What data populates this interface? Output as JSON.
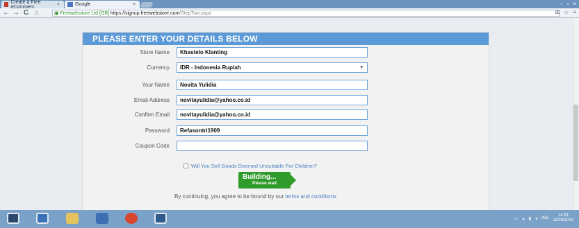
{
  "browser": {
    "tabs": [
      {
        "label": "Create a Free eCommerc",
        "close": "×"
      },
      {
        "label": "Google",
        "close": "×"
      }
    ],
    "window_controls": [
      "–",
      "▫",
      "×"
    ],
    "url": {
      "secure_label": "Freewebstore Ltd [GB]",
      "host": "https://signup.freewebstore.com",
      "path": "/StepTwo.aspx"
    },
    "nav": {
      "back": "←",
      "forward": "→",
      "reload": "C",
      "home": "⌂"
    },
    "toolbar_icons": [
      "⊞",
      "☆",
      "≡"
    ]
  },
  "form": {
    "header": "PLEASE ENTER YOUR DETAILS BELOW",
    "fields": [
      {
        "label": "Store Name",
        "value": "Khastelo Klanting"
      },
      {
        "label": "Currency",
        "value": "IDR - Indonesia Rupiah"
      },
      {
        "label": "Your Name",
        "value": "Novita Yulidia"
      },
      {
        "label": "Email Address",
        "value": "novitayulidia@yahoo.co.id"
      },
      {
        "label": "Confirm Email",
        "value": "novitayulidia@yahoo.co.id"
      },
      {
        "label": "Password",
        "value": "Refasontri1909"
      },
      {
        "label": "Coupon Code",
        "value": ""
      }
    ],
    "checkbox_label": "Will You Sell Goods Deemed Unsuitable For Children?",
    "button_title": "Building...",
    "button_sub": "Please wait",
    "agree_text": "By continuing, you agree to be bound by our ",
    "agree_link": "terms and conditions"
  },
  "taskbar": {
    "clock_time": "14:33",
    "clock_date": "11/09/2014",
    "lang": "IND"
  },
  "colors": {
    "header_blue": "#5b9ad6",
    "field_border": "#6aa3d8",
    "button_green": "#2e9b2a",
    "link_blue": "#4a7fc1"
  }
}
